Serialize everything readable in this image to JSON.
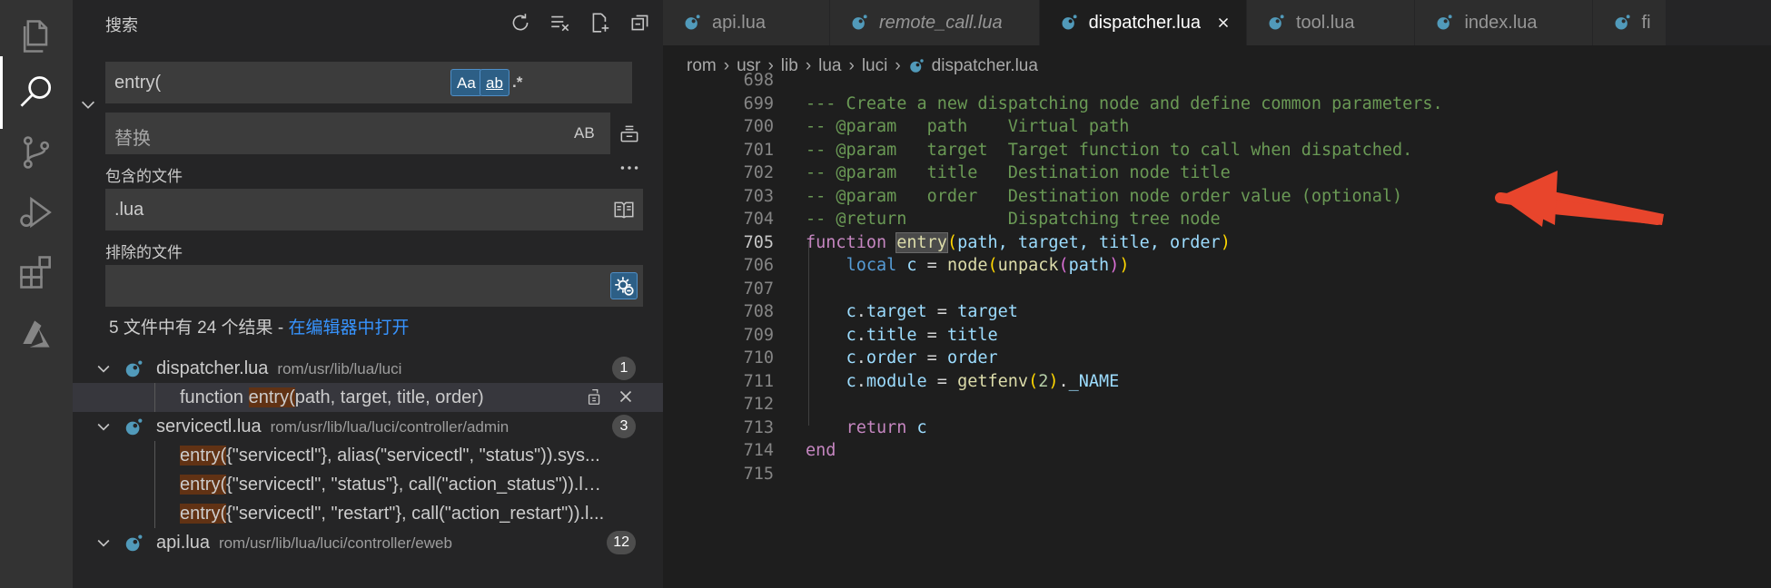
{
  "activity_bar": {
    "items": [
      {
        "icon": "explorer-icon"
      },
      {
        "icon": "search-icon",
        "active": true
      },
      {
        "icon": "source-control-icon"
      },
      {
        "icon": "run-debug-icon"
      },
      {
        "icon": "extensions-icon"
      },
      {
        "icon": "azure-icon"
      }
    ]
  },
  "sidebar": {
    "title": "搜索",
    "search": {
      "value": "entry(",
      "match_case_label": "Aa",
      "whole_word_label": "ab",
      "regex_label": ".*"
    },
    "replace": {
      "placeholder": "替换",
      "preserve_case_label": "AB"
    },
    "include": {
      "label": "包含的文件",
      "value": ".lua"
    },
    "exclude": {
      "label": "排除的文件",
      "value": ""
    },
    "summary": {
      "text": "5 文件中有 24 个结果 - ",
      "link": "在编辑器中打开"
    },
    "results": [
      {
        "file": "dispatcher.lua",
        "path": "rom/usr/lib/lua/luci",
        "count": "1",
        "matches": [
          {
            "pre": "function ",
            "hl": "entry(",
            "post": "path, target, title, order)"
          }
        ]
      },
      {
        "file": "servicectl.lua",
        "path": "rom/usr/lib/lua/luci/controller/admin",
        "count": "3",
        "matches": [
          {
            "pre": "",
            "hl": "entry(",
            "post": "{\"servicectl\"}, alias(\"servicectl\", \"status\")).sys..."
          },
          {
            "pre": "",
            "hl": "entry(",
            "post": "{\"servicectl\", \"status\"}, call(\"action_status\")).le..."
          },
          {
            "pre": "",
            "hl": "entry(",
            "post": "{\"servicectl\", \"restart\"}, call(\"action_restart\")).l..."
          }
        ]
      },
      {
        "file": "api.lua",
        "path": "rom/usr/lib/lua/luci/controller/eweb",
        "count": "12",
        "matches": []
      }
    ]
  },
  "editor": {
    "tabs": [
      {
        "label": "api.lua",
        "italic": false,
        "active": false
      },
      {
        "label": "remote_call.lua",
        "italic": true,
        "active": false
      },
      {
        "label": "dispatcher.lua",
        "italic": false,
        "active": true
      },
      {
        "label": "tool.lua",
        "italic": false,
        "active": false
      },
      {
        "label": "index.lua",
        "italic": false,
        "active": false
      },
      {
        "label": "fi",
        "italic": false,
        "active": false
      }
    ],
    "breadcrumb": [
      "rom",
      "usr",
      "lib",
      "lua",
      "luci",
      "dispatcher.lua"
    ],
    "current_line": "705",
    "lines": [
      {
        "n": "698"
      },
      {
        "n": "699"
      },
      {
        "n": "700"
      },
      {
        "n": "701"
      },
      {
        "n": "702"
      },
      {
        "n": "703"
      },
      {
        "n": "704"
      },
      {
        "n": "705"
      },
      {
        "n": "706"
      },
      {
        "n": "707"
      },
      {
        "n": "708"
      },
      {
        "n": "709"
      },
      {
        "n": "710"
      },
      {
        "n": "711"
      },
      {
        "n": "712"
      },
      {
        "n": "713"
      },
      {
        "n": "714"
      },
      {
        "n": "715"
      }
    ],
    "code": {
      "l699": "--- Create a new dispatching node and define common parameters.",
      "l700": "-- @param   path    Virtual path",
      "l701": "-- @param   target  Target function to call when dispatched.",
      "l702": "-- @param   title   Destination node title",
      "l703": "-- @param   order   Destination node order value (optional)",
      "l704": "-- @return          Dispatching tree node",
      "kw_function": "function",
      "fn_entry": "entry",
      "args": "path, target, title, order",
      "kw_local": "local",
      "var_c": "c",
      "fn_node": "node",
      "fn_unpack": "unpack",
      "var_path": "path",
      "f_target": "target",
      "f_title": "title",
      "f_order": "order",
      "f_module": "module",
      "fn_getfenv": "getfenv",
      "num_2": "2",
      "f_name": "_NAME",
      "kw_return": "return",
      "kw_end": "end"
    }
  },
  "colors": {
    "accent_link": "#3794ff",
    "annotation_arrow": "#e8452c",
    "match_highlight": "#613214"
  }
}
